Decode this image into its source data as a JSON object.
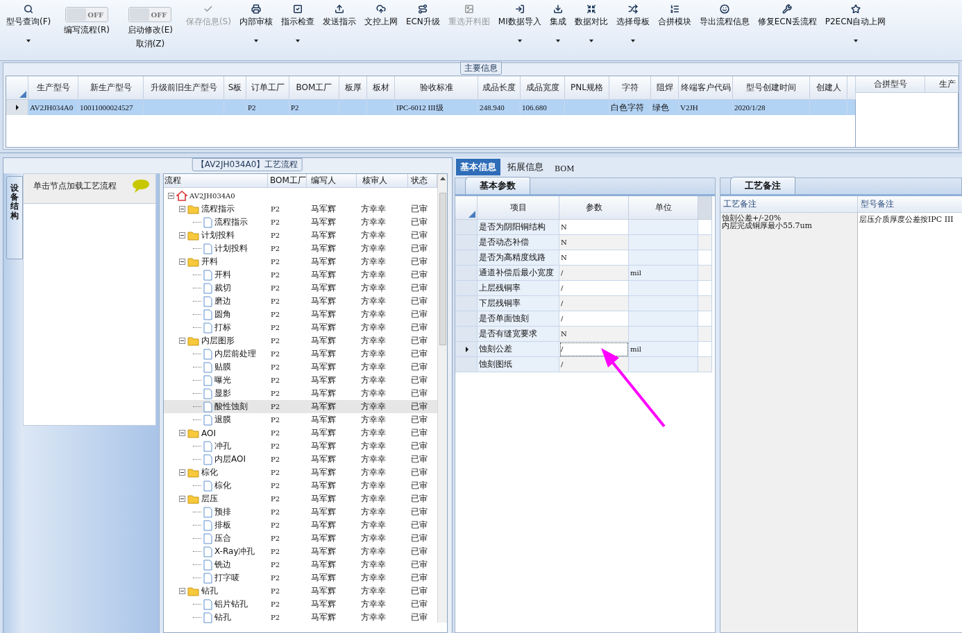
{
  "toolbar": [
    {
      "kind": "button",
      "label": "型号查询(F)",
      "dropdown": true,
      "disabled": false
    },
    {
      "kind": "toggle",
      "label": "编写流程(R)",
      "switch_text": "OFF",
      "on": false
    },
    {
      "kind": "toggle",
      "label": "启动修改(E)",
      "label2": "取消(Z)",
      "switch_text": "OFF",
      "on": false
    },
    {
      "kind": "button",
      "label": "保存信息(S)",
      "dropdown": false,
      "disabled": true
    },
    {
      "kind": "button",
      "label": "内部审核",
      "dropdown": true,
      "disabled": false
    },
    {
      "kind": "button",
      "label": "指示检查",
      "dropdown": true,
      "disabled": false
    },
    {
      "kind": "button",
      "label": "发送指示",
      "dropdown": false,
      "disabled": false
    },
    {
      "kind": "button",
      "label": "文控上网",
      "dropdown": false,
      "disabled": false
    },
    {
      "kind": "button",
      "label": "ECN升级",
      "dropdown": false,
      "disabled": false
    },
    {
      "kind": "button",
      "label": "重选开料图",
      "dropdown": false,
      "disabled": true
    },
    {
      "kind": "button",
      "label": "MI数据导入",
      "dropdown": true,
      "disabled": false
    },
    {
      "kind": "button",
      "label": "集成",
      "dropdown": true,
      "disabled": false
    },
    {
      "kind": "button",
      "label": "数据对比",
      "dropdown": true,
      "disabled": false
    },
    {
      "kind": "button",
      "label": "选择母板",
      "dropdown": true,
      "disabled": false
    },
    {
      "kind": "button",
      "label": "合拼模块",
      "dropdown": false,
      "disabled": false
    },
    {
      "kind": "button",
      "label": "导出流程信息",
      "dropdown": false,
      "disabled": false
    },
    {
      "kind": "button",
      "label": "修复ECN丢流程",
      "dropdown": false,
      "disabled": false
    },
    {
      "kind": "button",
      "label": "P2ECN自动上网",
      "dropdown": true,
      "disabled": false
    }
  ],
  "main_info": {
    "title": "主要信息",
    "columns": [
      "生产型号",
      "新生产型号",
      "升级前旧生产型号",
      "S板",
      "订单工厂",
      "BOM工厂",
      "板厚",
      "板材",
      "验收标准",
      "成品长度",
      "成品宽度",
      "PNL规格",
      "字符",
      "阻焊",
      "终端客户代码",
      "型号创建时间",
      "创建人"
    ],
    "rows": [
      {
        "selected": true,
        "cells": [
          "AV2JH034A0",
          "10011000024527",
          "",
          "",
          "P2",
          "P2",
          "",
          "",
          "IPC-6012 III级",
          "248.940",
          "106.680",
          "",
          "白色字符",
          "绿色",
          "V2JH",
          "2020/1/28",
          ""
        ]
      }
    ],
    "side_columns": [
      "合拼型号",
      "生产"
    ]
  },
  "side_tab": "设备结构",
  "node_panel": {
    "hint": "单击节点加载工艺流程"
  },
  "process": {
    "title": "【AV2JH034A0】工艺流程",
    "columns": [
      "流程",
      "BOM工厂",
      "编写人",
      "核审人",
      "状态"
    ],
    "tree": [
      {
        "label": "AV2JH034A0",
        "kind": "root",
        "expanded": true,
        "selected": false,
        "cells": [
          "",
          "",
          "",
          ""
        ],
        "children": [
          {
            "label": "流程指示",
            "kind": "folder",
            "expanded": true,
            "selected": false,
            "cells": [
              "P2",
              "马军辉",
              "方幸幸",
              "已审"
            ],
            "children": [
              {
                "label": "流程指示",
                "kind": "step",
                "selected": false,
                "cells": [
                  "P2",
                  "马军辉",
                  "方幸幸",
                  "已审"
                ]
              }
            ]
          },
          {
            "label": "计划投料",
            "kind": "folder",
            "expanded": true,
            "selected": false,
            "cells": [
              "P2",
              "马军辉",
              "方幸幸",
              "已审"
            ],
            "children": [
              {
                "label": "计划投料",
                "kind": "step",
                "selected": false,
                "cells": [
                  "P2",
                  "马军辉",
                  "方幸幸",
                  "已审"
                ]
              }
            ]
          },
          {
            "label": "开料",
            "kind": "folder",
            "expanded": true,
            "selected": false,
            "cells": [
              "P2",
              "马军辉",
              "方幸幸",
              "已审"
            ],
            "children": [
              {
                "label": "开料",
                "kind": "step",
                "selected": false,
                "cells": [
                  "P2",
                  "马军辉",
                  "方幸幸",
                  "已审"
                ]
              },
              {
                "label": "裁切",
                "kind": "step",
                "selected": false,
                "cells": [
                  "P2",
                  "马军辉",
                  "方幸幸",
                  "已审"
                ]
              },
              {
                "label": "磨边",
                "kind": "step",
                "selected": false,
                "cells": [
                  "P2",
                  "马军辉",
                  "方幸幸",
                  "已审"
                ]
              },
              {
                "label": "圆角",
                "kind": "step",
                "selected": false,
                "cells": [
                  "P2",
                  "马军辉",
                  "方幸幸",
                  "已审"
                ]
              },
              {
                "label": "打标",
                "kind": "step",
                "selected": false,
                "cells": [
                  "P2",
                  "马军辉",
                  "方幸幸",
                  "已审"
                ]
              }
            ]
          },
          {
            "label": "内层图形",
            "kind": "folder",
            "expanded": true,
            "selected": false,
            "cells": [
              "P2",
              "马军辉",
              "方幸幸",
              "已审"
            ],
            "children": [
              {
                "label": "内层前处理",
                "kind": "step",
                "selected": false,
                "cells": [
                  "P2",
                  "马军辉",
                  "方幸幸",
                  "已审"
                ]
              },
              {
                "label": "贴膜",
                "kind": "step",
                "selected": false,
                "cells": [
                  "P2",
                  "马军辉",
                  "方幸幸",
                  "已审"
                ]
              },
              {
                "label": "曝光",
                "kind": "step",
                "selected": false,
                "cells": [
                  "P2",
                  "马军辉",
                  "方幸幸",
                  "已审"
                ]
              },
              {
                "label": "显影",
                "kind": "step",
                "selected": false,
                "cells": [
                  "P2",
                  "马军辉",
                  "方幸幸",
                  "已审"
                ]
              },
              {
                "label": "酸性蚀刻",
                "kind": "step",
                "selected": true,
                "cells": [
                  "P2",
                  "马军辉",
                  "方幸幸",
                  "已审"
                ]
              },
              {
                "label": "退膜",
                "kind": "step",
                "selected": false,
                "cells": [
                  "P2",
                  "马军辉",
                  "方幸幸",
                  "已审"
                ]
              }
            ]
          },
          {
            "label": "AOI",
            "kind": "folder",
            "expanded": true,
            "selected": false,
            "cells": [
              "P2",
              "马军辉",
              "方幸幸",
              "已审"
            ],
            "children": [
              {
                "label": "冲孔",
                "kind": "step",
                "selected": false,
                "cells": [
                  "P2",
                  "马军辉",
                  "方幸幸",
                  "已审"
                ]
              },
              {
                "label": "内层AOI",
                "kind": "step",
                "selected": false,
                "cells": [
                  "P2",
                  "马军辉",
                  "方幸幸",
                  "已审"
                ]
              }
            ]
          },
          {
            "label": "棕化",
            "kind": "folder",
            "expanded": true,
            "selected": false,
            "cells": [
              "P2",
              "马军辉",
              "方幸幸",
              "已审"
            ],
            "children": [
              {
                "label": "棕化",
                "kind": "step",
                "selected": false,
                "cells": [
                  "P2",
                  "马军辉",
                  "方幸幸",
                  "已审"
                ]
              }
            ]
          },
          {
            "label": "层压",
            "kind": "folder",
            "expanded": true,
            "selected": false,
            "cells": [
              "P2",
              "马军辉",
              "方幸幸",
              "已审"
            ],
            "children": [
              {
                "label": "预排",
                "kind": "step",
                "selected": false,
                "cells": [
                  "P2",
                  "马军辉",
                  "方幸幸",
                  "已审"
                ]
              },
              {
                "label": "排板",
                "kind": "step",
                "selected": false,
                "cells": [
                  "P2",
                  "马军辉",
                  "方幸幸",
                  "已审"
                ]
              },
              {
                "label": "压合",
                "kind": "step",
                "selected": false,
                "cells": [
                  "P2",
                  "马军辉",
                  "方幸幸",
                  "已审"
                ]
              },
              {
                "label": "X-Ray冲孔",
                "kind": "step",
                "selected": false,
                "cells": [
                  "P2",
                  "马军辉",
                  "方幸幸",
                  "已审"
                ]
              },
              {
                "label": "铣边",
                "kind": "step",
                "selected": false,
                "cells": [
                  "P2",
                  "马军辉",
                  "方幸幸",
                  "已审"
                ]
              },
              {
                "label": "打字唛",
                "kind": "step",
                "selected": false,
                "cells": [
                  "P2",
                  "马军辉",
                  "方幸幸",
                  "已审"
                ]
              }
            ]
          },
          {
            "label": "钻孔",
            "kind": "folder",
            "expanded": true,
            "selected": false,
            "cells": [
              "P2",
              "马军辉",
              "方幸幸",
              "已审"
            ],
            "children": [
              {
                "label": "铝片钻孔",
                "kind": "step",
                "selected": false,
                "cells": [
                  "P2",
                  "马军辉",
                  "方幸幸",
                  "已审"
                ]
              },
              {
                "label": "钻孔",
                "kind": "step",
                "selected": false,
                "cells": [
                  "P2",
                  "马军辉",
                  "方幸幸",
                  "已审"
                ]
              }
            ]
          }
        ]
      }
    ]
  },
  "detail_tabs": [
    {
      "label": "基本信息",
      "selected": true
    },
    {
      "label": "拓展信息",
      "selected": false
    },
    {
      "label": "BOM",
      "selected": false
    }
  ],
  "params": {
    "tab": "基本参数",
    "columns": [
      "项目",
      "参数",
      "单位"
    ],
    "rows": [
      {
        "item": "是否为阴阳铜结构",
        "value": "N",
        "unit": "",
        "current": false
      },
      {
        "item": "是否动态补偿",
        "value": "N",
        "unit": "",
        "current": false
      },
      {
        "item": "是否为高精度线路",
        "value": "N",
        "unit": "",
        "current": false
      },
      {
        "item": "通道补偿后最小宽度",
        "value": "/",
        "unit": "mil",
        "current": false
      },
      {
        "item": "上层残铜率",
        "value": "/",
        "unit": "",
        "current": false
      },
      {
        "item": "下层残铜率",
        "value": "/",
        "unit": "",
        "current": false
      },
      {
        "item": "是否单面蚀刻",
        "value": "/",
        "unit": "",
        "current": false
      },
      {
        "item": "是否有缝宽要求",
        "value": "N",
        "unit": "",
        "current": false
      },
      {
        "item": "蚀刻公差",
        "value": "/",
        "unit": "mil",
        "current": true
      },
      {
        "item": "蚀刻图纸",
        "value": "/",
        "unit": "",
        "current": false
      }
    ]
  },
  "notes": {
    "tab": "工艺备注",
    "columns": [
      "工艺备注",
      "型号备注"
    ],
    "process_note": [
      "蚀刻公差+/-20%",
      "内层完成铜厚最小55.7um"
    ],
    "model_note": "层压介质厚度公差按IPC III"
  }
}
